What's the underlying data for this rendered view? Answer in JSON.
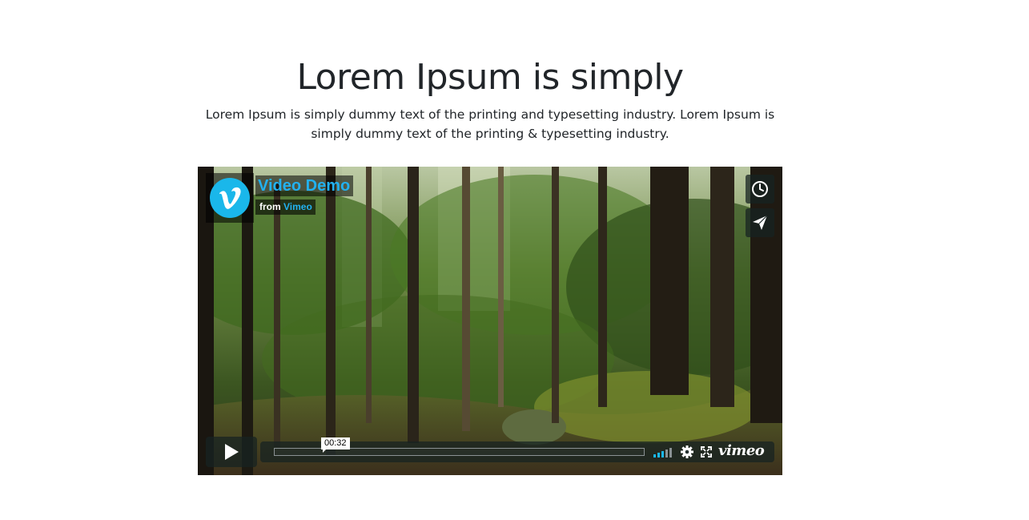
{
  "heading": "Lorem Ipsum is simply",
  "description": "Lorem Ipsum is simply dummy text of the printing and typesetting industry. Lorem Ipsum is simply dummy text of the printing & typesetting industry.",
  "video": {
    "title": "Video Demo",
    "byline_prefix": "from",
    "byline_owner": "Vimeo",
    "timecode": "00:32",
    "progress": 0,
    "volume_level": 0.6,
    "brand": "vimeo",
    "thumbnail": "forest scene",
    "icons": {
      "logo": "vimeo-logo",
      "watch_later": "clock-icon",
      "share": "paper-plane-icon",
      "play": "play-icon",
      "volume": "volume-bars-icon",
      "settings": "gear-icon",
      "fullscreen": "fullscreen-icon"
    },
    "colors": {
      "accent": "#1ab7ea",
      "control_bg": "#172322"
    }
  }
}
